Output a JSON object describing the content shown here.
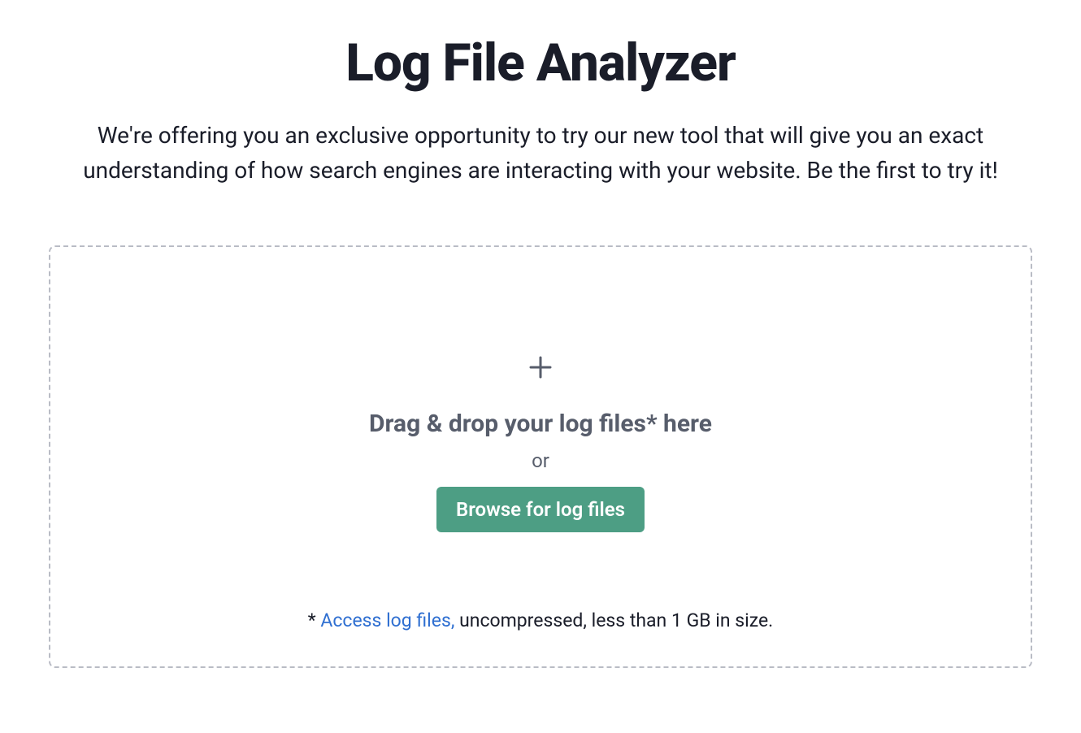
{
  "header": {
    "title": "Log File Analyzer",
    "subtitle": "We're offering you an exclusive opportunity to try our new tool that will give you an exact understanding of how search engines are interacting with your website. Be the first to try it!"
  },
  "dropzone": {
    "drag_text": "Drag & drop your log files* here",
    "or_text": "or",
    "browse_label": "Browse for log files",
    "footnote_prefix": "* ",
    "footnote_link": "Access log files,",
    "footnote_suffix": " uncompressed, less than 1 GB in size."
  }
}
